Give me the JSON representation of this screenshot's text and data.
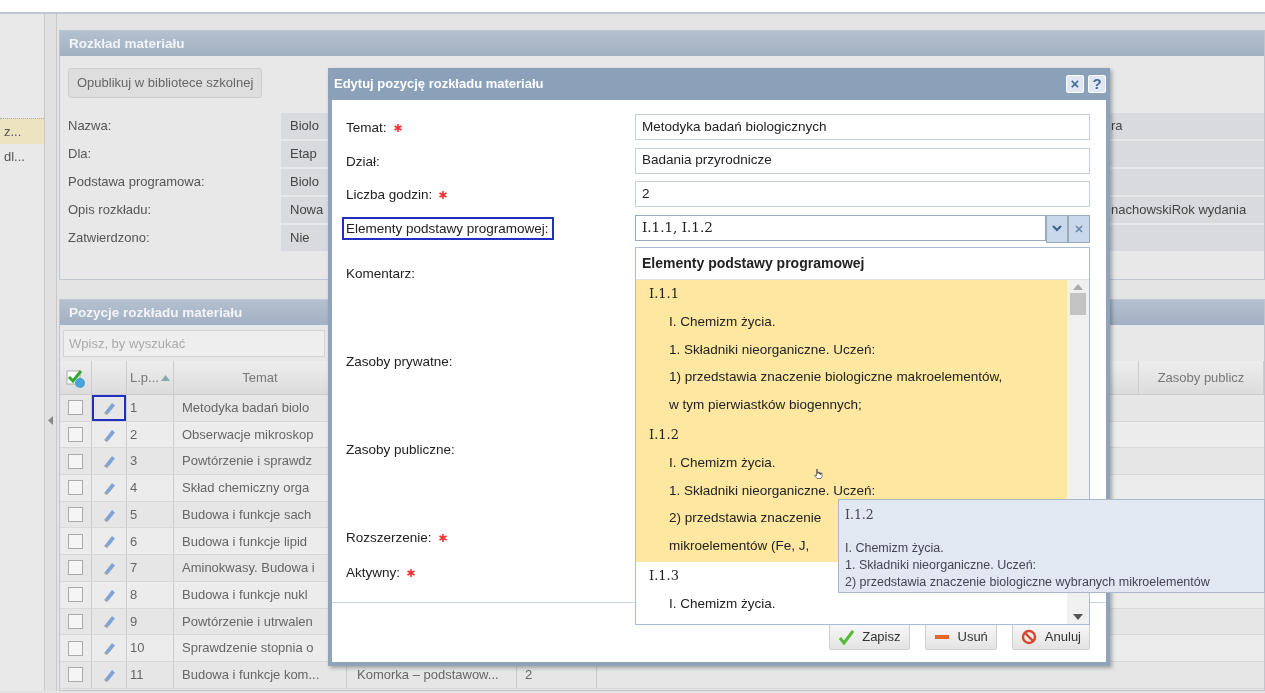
{
  "sidebar": {
    "items": [
      {
        "label": "z...",
        "selected": true
      },
      {
        "label": "dl...",
        "selected": false
      }
    ]
  },
  "plan_panel": {
    "title": "Rozkład materiału",
    "publish_button": "Opublikuj w bibliotece szkolnej",
    "fields": [
      {
        "label": "Nazwa:",
        "value": "Biolo",
        "value_right": "ra"
      },
      {
        "label": "Dla:",
        "value": "Etap"
      },
      {
        "label": "Podstawa programowa:",
        "value": "Biolo"
      },
      {
        "label": "Opis rozkładu:",
        "value": "Nowa",
        "value_right": "nachowskiRok wydania"
      },
      {
        "label": "Zatwierdzono:",
        "value": "Nie"
      }
    ]
  },
  "positions_panel": {
    "title": "Pozycje rozkładu materiału",
    "search": {
      "placeholder": "Wpisz, by wyszukać"
    },
    "columns": [
      {
        "kind": "select"
      },
      {
        "kind": "edit"
      },
      {
        "kind": "lp",
        "label": "L.p...",
        "sort_ascending": true
      },
      {
        "kind": "text",
        "label": "Temat"
      },
      {
        "kind": "filler"
      },
      {
        "kind": "text",
        "label": "Zasoby publicz"
      }
    ],
    "rows": [
      {
        "checked": false,
        "edit_highlighted": true,
        "lp": "1",
        "temat": "Metodyka badań biolo"
      },
      {
        "checked": false,
        "edit_highlighted": false,
        "lp": "2",
        "temat": "Obserwacje mikroskop"
      },
      {
        "checked": false,
        "edit_highlighted": false,
        "lp": "3",
        "temat": "Powtórzenie i sprawdz"
      },
      {
        "checked": false,
        "edit_highlighted": false,
        "lp": "4",
        "temat": "Skład chemiczny orga"
      },
      {
        "checked": false,
        "edit_highlighted": false,
        "lp": "5",
        "temat": "Budowa i funkcje sach"
      },
      {
        "checked": false,
        "edit_highlighted": false,
        "lp": "6",
        "temat": "Budowa i funkcje lipid"
      },
      {
        "checked": false,
        "edit_highlighted": false,
        "lp": "7",
        "temat": "Aminokwasy. Budowa i"
      },
      {
        "checked": false,
        "edit_highlighted": false,
        "lp": "8",
        "temat": "Budowa i funkcje nukl"
      },
      {
        "checked": false,
        "edit_highlighted": false,
        "lp": "9",
        "temat": "Powtórzenie i utrwalen"
      },
      {
        "checked": false,
        "edit_highlighted": false,
        "lp": "10",
        "temat": "Sprawdzenie stopnia o"
      },
      {
        "checked": false,
        "edit_highlighted": false,
        "lp": "11",
        "temat": "Budowa i funkcje kom...",
        "dzial": "Komorka – podstawow...",
        "godziny": "2"
      }
    ]
  },
  "dialog": {
    "title": "Edytuj pozycję rozkładu materiału",
    "close": "×",
    "help": "?",
    "fields": [
      {
        "kind": "text",
        "label": "Temat:",
        "required": true,
        "highlighted": false,
        "value": "Metodyka badań biologicznych"
      },
      {
        "kind": "text",
        "label": "Dział:",
        "required": false,
        "highlighted": false,
        "value": "Badania przyrodnicze"
      },
      {
        "kind": "text",
        "label": "Liczba godzin:",
        "required": true,
        "highlighted": false,
        "value": "2"
      },
      {
        "kind": "combo",
        "label": "Elementy podstawy programowej:",
        "required": false,
        "highlighted": true,
        "value": "I.1.1, I.1.2"
      },
      {
        "kind": "area",
        "label": "Komentarz:",
        "required": false,
        "highlighted": false
      },
      {
        "kind": "area",
        "label": "Zasoby prywatne:",
        "required": false,
        "highlighted": false
      },
      {
        "kind": "area",
        "label": "Zasoby publiczne:",
        "required": false,
        "highlighted": false
      },
      {
        "kind": "check",
        "label": "Rozszerzenie:",
        "required": true,
        "highlighted": false
      },
      {
        "kind": "check",
        "label": "Aktywny:",
        "required": true,
        "highlighted": false
      }
    ],
    "dropdown": {
      "header": "Elementy podstawy programowej",
      "items": [
        {
          "code": "I.1.1",
          "selected": true,
          "lines": [
            "I. Chemizm życia.",
            "1. Składniki nieorganiczne. Uczeń:",
            "1) przedstawia znaczenie biologiczne makroelementów,",
            "w tym pierwiastków biogennych;"
          ]
        },
        {
          "code": "I.1.2",
          "selected": true,
          "lines": [
            "I. Chemizm życia.",
            "1. Składniki nieorganiczne. Uczeń:",
            "2) przedstawia znaczenie",
            "mikroelementów (Fe, J,"
          ]
        },
        {
          "code": "I.1.3",
          "selected": false,
          "lines": [
            "I. Chemizm życia."
          ]
        }
      ]
    },
    "buttons": [
      {
        "kind": "save",
        "label": "Zapisz"
      },
      {
        "kind": "delete",
        "label": "Usuń"
      },
      {
        "kind": "cancel",
        "label": "Anuluj"
      }
    ]
  },
  "tooltip": {
    "title": "I.1.2",
    "lines": [
      "I. Chemizm życia.",
      "1. Składniki nieorganiczne. Uczeń:",
      "2) przedstawia znaczenie biologiczne wybranych mikroelementów"
    ]
  }
}
